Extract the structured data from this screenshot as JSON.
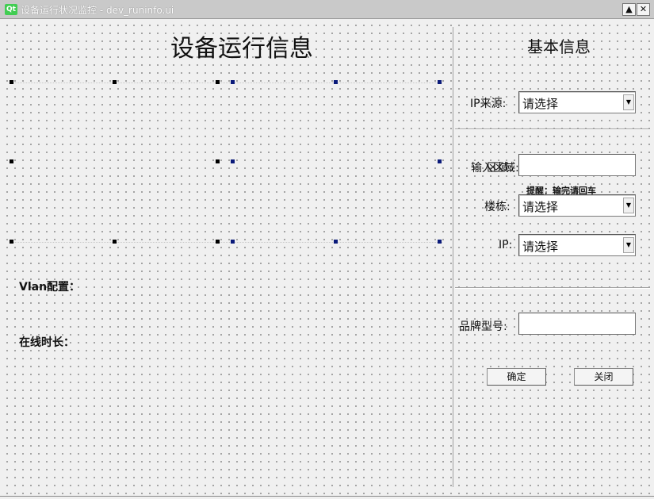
{
  "window": {
    "title": "设备运行状况监控 - dev_runinfo.ui",
    "logo_text": "Qt",
    "restore_glyph": "▲",
    "close_glyph": "✕"
  },
  "main": {
    "title": "设备运行信息",
    "vlan_label": "Vlan配置：",
    "online_label": "在线时长："
  },
  "side": {
    "title": "基本信息",
    "ip_source": {
      "label": "IP来源:",
      "value": "请选择"
    },
    "area": {
      "label": "输入区域:",
      "overlap_label": "区域:"
    },
    "hint": "提醒：输完请回车",
    "building": {
      "label": "楼栋:",
      "value": "请选择"
    },
    "ip": {
      "label": "IP:",
      "value": "请选择"
    },
    "brand": {
      "label": "品牌型号:"
    },
    "ok_button": "确定",
    "close_button": "关闭"
  },
  "icons": {
    "combo_arrow": "▼"
  }
}
